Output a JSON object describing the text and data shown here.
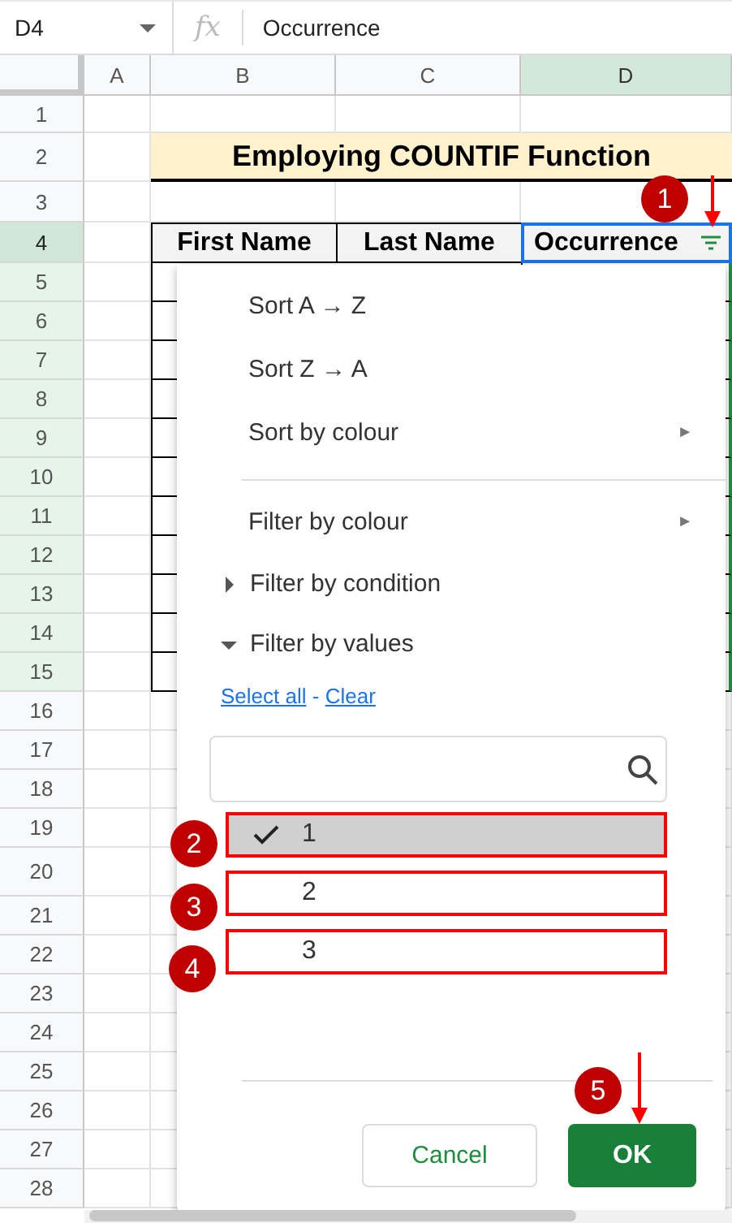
{
  "formula_bar": {
    "name_box": "D4",
    "fx": "fx",
    "value": "Occurrence"
  },
  "columns": [
    {
      "label": "A",
      "selected": false
    },
    {
      "label": "B",
      "selected": false
    },
    {
      "label": "C",
      "selected": false
    },
    {
      "label": "D",
      "selected": true
    }
  ],
  "rows": [
    {
      "label": "1",
      "selected": false,
      "current": false
    },
    {
      "label": "2",
      "selected": false,
      "current": false
    },
    {
      "label": "3",
      "selected": false,
      "current": false
    },
    {
      "label": "4",
      "selected": true,
      "current": true
    },
    {
      "label": "5",
      "selected": true,
      "current": false
    },
    {
      "label": "6",
      "selected": true,
      "current": false
    },
    {
      "label": "7",
      "selected": true,
      "current": false
    },
    {
      "label": "8",
      "selected": true,
      "current": false
    },
    {
      "label": "9",
      "selected": true,
      "current": false
    },
    {
      "label": "10",
      "selected": true,
      "current": false
    },
    {
      "label": "11",
      "selected": true,
      "current": false
    },
    {
      "label": "12",
      "selected": true,
      "current": false
    },
    {
      "label": "13",
      "selected": true,
      "current": false
    },
    {
      "label": "14",
      "selected": true,
      "current": false
    },
    {
      "label": "15",
      "selected": true,
      "current": false
    },
    {
      "label": "16",
      "selected": false,
      "current": false
    },
    {
      "label": "17",
      "selected": false,
      "current": false
    },
    {
      "label": "18",
      "selected": false,
      "current": false
    },
    {
      "label": "19",
      "selected": false,
      "current": false
    },
    {
      "label": "20",
      "selected": false,
      "current": false
    },
    {
      "label": "21",
      "selected": false,
      "current": false
    },
    {
      "label": "22",
      "selected": false,
      "current": false
    },
    {
      "label": "23",
      "selected": false,
      "current": false
    },
    {
      "label": "24",
      "selected": false,
      "current": false
    },
    {
      "label": "25",
      "selected": false,
      "current": false
    },
    {
      "label": "26",
      "selected": false,
      "current": false
    },
    {
      "label": "27",
      "selected": false,
      "current": false
    },
    {
      "label": "28",
      "selected": false,
      "current": false
    }
  ],
  "sheet_title": "Employing COUNTIF Function",
  "table_headers": [
    "First Name",
    "Last Name",
    "Occurrence"
  ],
  "filter_menu": {
    "items": [
      {
        "kind": "action",
        "label": "Sort A → Z"
      },
      {
        "kind": "action",
        "label": "Sort Z → A"
      },
      {
        "kind": "submenu",
        "label": "Sort by colour",
        "arrow": "►"
      },
      {
        "kind": "divider"
      },
      {
        "kind": "submenu",
        "label": "Filter by colour",
        "arrow": "►"
      },
      {
        "kind": "section",
        "label": "Filter by condition",
        "expanded": false
      },
      {
        "kind": "section",
        "label": "Filter by values",
        "expanded": true
      }
    ],
    "links": {
      "select_all": "Select all",
      "separator": "-",
      "clear": "Clear"
    },
    "values": [
      {
        "label": "1",
        "checked": true,
        "marked": true
      },
      {
        "label": "2",
        "checked": false,
        "marked": true
      },
      {
        "label": "3",
        "checked": false,
        "marked": true
      }
    ],
    "buttons": {
      "cancel": "Cancel",
      "ok": "OK"
    }
  },
  "annotations": [
    {
      "label": "1",
      "kind": "arrowed"
    },
    {
      "label": "2",
      "kind": "plain"
    },
    {
      "label": "3",
      "kind": "plain"
    },
    {
      "label": "4",
      "kind": "plain"
    },
    {
      "label": "5",
      "kind": "arrowed"
    }
  ]
}
